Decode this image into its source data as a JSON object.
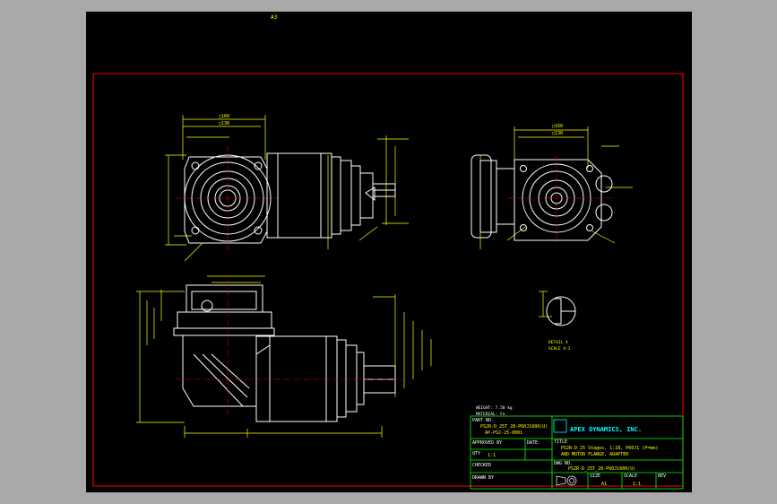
{
  "top_mark": "A3",
  "notes": {
    "weight": "WEIGHT: 7.50 kg",
    "material": "MATERIAL: Fe"
  },
  "labels": {
    "detail": "DETAIL A",
    "scale": "SCALE 4:1",
    "view_dim_a": "□160",
    "view_dim_b": "□130"
  },
  "title_block": {
    "part_no_label": "PART NO.",
    "part_no_value": "PS2R-D_25T_28-P60J1600(U)",
    "part_no_value2": "AP-PS2-25-0001",
    "company": "APEX DYNAMICS, INC.",
    "title_label": "TITLE",
    "title_line1": "PS2R-D_25 Stages, 1:28, P60J1 (P=mm)",
    "title_line2": "AND MOTOR FLANGE, ADAPTER",
    "approved_label": "APPROVED BY",
    "date_label": "DATE",
    "qty_label": "QTY",
    "qty_value": "1:1",
    "dwg_no_label": "DWG NO.",
    "dwg_no_value": "PS2R-D_25T_28-P60J1600(U)",
    "checked_label": "CHECKED",
    "drawn_label": "DRAWN BY",
    "size_label": "SIZE",
    "size_value": "A1",
    "scale_label": "SCALE",
    "scale_value": "1:1",
    "rev_label": "REV"
  },
  "colors": {
    "background": "#000000",
    "border": "#ff0000",
    "geometry": "#ffffff",
    "dimensions": "#ffff00",
    "title_frame": "#00ff00",
    "logo": "#00ffff"
  }
}
